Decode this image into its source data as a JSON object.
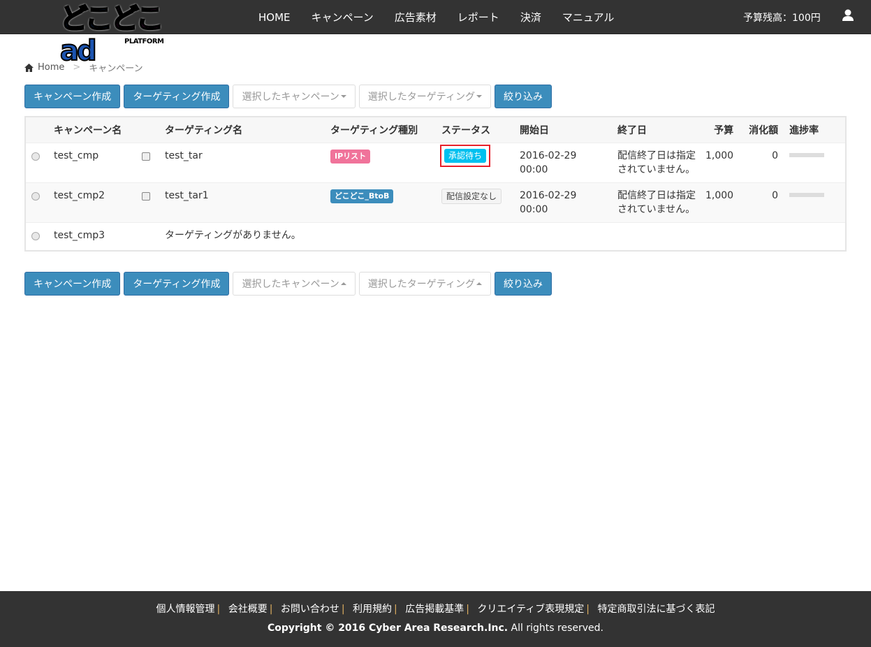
{
  "header": {
    "logo_text": "どこどこad",
    "logo_sub": "PLATFORM",
    "menu": [
      "HOME",
      "キャンペーン",
      "広告素材",
      "レポート",
      "決済",
      "マニュアル"
    ],
    "budget": "予算残高：100円"
  },
  "breadcrumb": {
    "home": "Home",
    "sep": ">",
    "current": "キャンペーン"
  },
  "toolbar": {
    "create_campaign": "キャンペーン作成",
    "create_targeting": "ターゲティング作成",
    "selected_campaign": "選択したキャンペーン",
    "selected_targeting": "選択したターゲティング",
    "filter": "絞り込み"
  },
  "table": {
    "headers": [
      "キャンペーン名",
      "ターゲティング名",
      "ターゲティング種別",
      "ステータス",
      "開始日",
      "終了日",
      "予算",
      "消化額",
      "進捗率"
    ],
    "rows": [
      {
        "campaign": "test_cmp",
        "targeting": "test_tar",
        "type": "IPリスト",
        "type_color": "#f0739a",
        "status": "承認待ち",
        "start": "2016-02-29",
        "start_time": "00:00",
        "end": "配信終了日は指定",
        "end2": "されていません。",
        "budget": "1,000",
        "spent": "0",
        "progress": 0
      },
      {
        "campaign": "test_cmp2",
        "targeting": "test_tar1",
        "type": "どこどこ_BtoB",
        "type_color": "#3c8dbc",
        "status": "配信設定なし",
        "start": "2016-02-29",
        "start_time": "00:00",
        "end": "配信終了日は指定",
        "end2": "されていません。",
        "budget": "1,000",
        "spent": "0",
        "progress": 0
      },
      {
        "campaign": "test_cmp3",
        "no_targeting": "ターゲティングがありません。"
      }
    ]
  },
  "footer": {
    "links": [
      "個人情報管理",
      "会社概要",
      "お問い合わせ",
      "利用規約",
      "広告掲載基準",
      "クリエイティブ表現規定",
      "特定商取引法に基づく表記"
    ],
    "separator": "|",
    "copyright_bold": "Copyright © 2016 Cyber Area Research.Inc.",
    "copyright_rest": " All rights reserved."
  }
}
